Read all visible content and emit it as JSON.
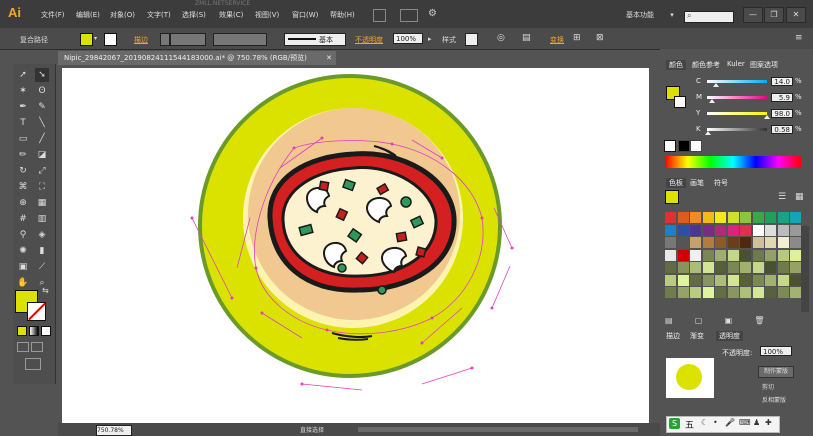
{
  "app": {
    "logo": "Ai",
    "watermark": "ZMLL.NETSERVICE"
  },
  "menu": [
    "文件(F)",
    "编辑(E)",
    "对象(O)",
    "文字(T)",
    "选择(S)",
    "效果(C)",
    "视图(V)",
    "窗口(W)",
    "帮助(H)"
  ],
  "workspace": {
    "label": "基本功能",
    "arrow": "▾"
  },
  "window_buttons": [
    "—",
    "❐",
    "✕"
  ],
  "control_bar": {
    "selection": "复合路径",
    "stroke_label": "描边",
    "stroke_style": "基本",
    "opacity_label": "不透明度",
    "opacity_value": "100%",
    "style_label": "样式",
    "transform_label": "变换"
  },
  "document": {
    "tab_title": "Nipic_29842067_20190824111544183000.ai* @ 750.78% (RGB/预览)",
    "close": "✕"
  },
  "status": {
    "zoom": "750.78%",
    "mode": "直接选择"
  },
  "color_panel": {
    "tabs": [
      "颜色",
      "颜色参考",
      "Kuler",
      "图案选项"
    ],
    "channels": [
      {
        "label": "C",
        "value": "14.0",
        "color": "#00aeef",
        "ratio": 0.14
      },
      {
        "label": "M",
        "value": "5.9",
        "color": "#ec008c",
        "ratio": 0.059
      },
      {
        "label": "Y",
        "value": "98.0",
        "color": "#fff200",
        "ratio": 0.98
      },
      {
        "label": "K",
        "value": "0.58",
        "color": "#333333",
        "ratio": 0.0058
      }
    ],
    "pct": "%",
    "fill_color": "#dce200"
  },
  "swatches_panel": {
    "tabs": [
      "色板",
      "画笔",
      "符号"
    ],
    "colors": [
      "#e03030",
      "#e05a20",
      "#f08c20",
      "#f5b81c",
      "#f5e81e",
      "#cfe02a",
      "#8cc63e",
      "#3aa84a",
      "#1e9f5a",
      "#16a38a",
      "#12a6b4",
      "#1e7fc3",
      "#2a4fa3",
      "#4c3690",
      "#7a2a88",
      "#b02a78",
      "#e0207a",
      "#e03050",
      "#ffffff",
      "#dddddd",
      "#bbbbbb",
      "#999999",
      "#777777",
      "#555555",
      "#c8a068",
      "#b07c40",
      "#8c5a2c",
      "#6a3e1c",
      "#4c2a12",
      "#d0c09a",
      "#e0d8b0",
      "#f4eed0",
      "#8a8a8a",
      "#e8e8e8",
      "#d00000",
      "#f0f0f0"
    ],
    "page": "100%"
  },
  "lower_panel": {
    "tabs": [
      "描边",
      "渐变",
      "透明度"
    ],
    "opacity_label": "不透明度:",
    "opacity_value": "100%",
    "mask_button": "制作蒙版",
    "clip": "剪切",
    "invert": "反相蒙版"
  },
  "pizza": {
    "plate_color": "#dce200",
    "plate_rim": "#6a9a2a",
    "crust_color": "#f0c890",
    "sauce_color": "#d42020",
    "cheese_color": "#fdf2cf",
    "outline": "#1a1a1a",
    "anchor_color": "#e040c0"
  },
  "ime": {
    "brand": "S",
    "text": "五"
  }
}
